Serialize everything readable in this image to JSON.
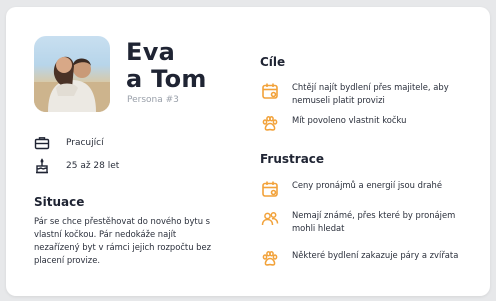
{
  "persona": {
    "name_line1": "Eva",
    "name_line2": "a Tom",
    "label": "Persona #3",
    "work": "Pracující",
    "age": "25 až 28 let"
  },
  "situation": {
    "heading": "Situace",
    "text": "Pár se chce přestěhovat do nového bytu s vlastní kočkou. Pár nedokáže najít nezařízený byt v rámci jejich rozpočtu bez placení provize."
  },
  "goals": {
    "heading": "Cíle",
    "items": [
      {
        "icon": "calendar-icon",
        "text": "Chtějí najít bydlení přes majitele, aby nemuseli platit provizi"
      },
      {
        "icon": "paw-icon",
        "text": "Mít povoleno vlastnit kočku"
      }
    ]
  },
  "frustrations": {
    "heading": "Frustrace",
    "items": [
      {
        "icon": "calendar-icon",
        "text": "Ceny pronájmů a energií jsou drahé"
      },
      {
        "icon": "people-icon",
        "text": "Nemají známé, přes které by pronájem mohli hledat"
      },
      {
        "icon": "paw-icon",
        "text": "Některé bydlení zakazuje páry a zvířata"
      }
    ]
  },
  "colors": {
    "accent": "#f2a23a",
    "text": "#1f2433",
    "muted": "#9aa0aa",
    "background": "#e7e8ea",
    "card": "#ffffff"
  }
}
